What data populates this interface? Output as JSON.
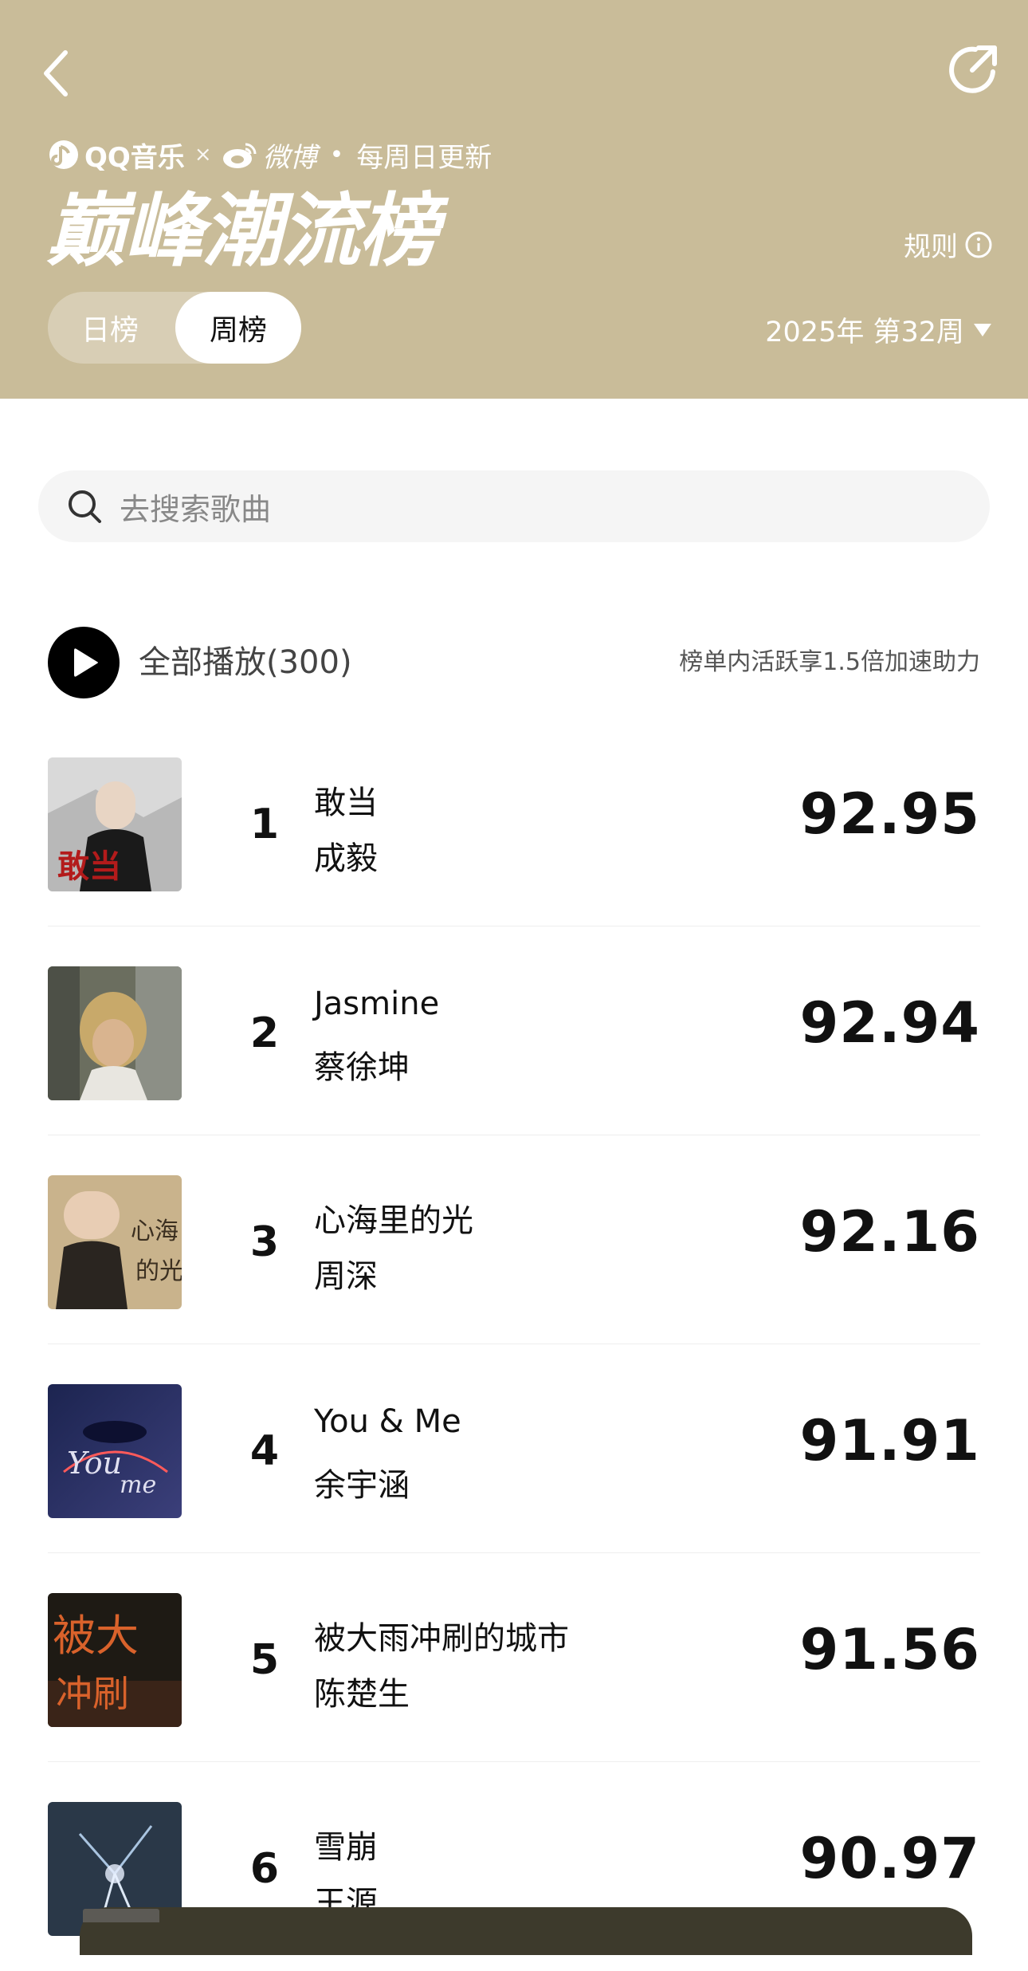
{
  "header": {
    "brand_qq": "QQ音乐",
    "brand_separator": "×",
    "brand_weibo": "微博",
    "update_note": "每周日更新",
    "title": "巅峰潮流榜",
    "rules_label": "规则",
    "tabs": [
      {
        "label": "日榜",
        "selected": false
      },
      {
        "label": "周榜",
        "selected": true
      }
    ],
    "week_selector": "2025年 第32周"
  },
  "search": {
    "placeholder": "去搜索歌曲"
  },
  "play_all": {
    "label": "全部播放(300)",
    "boost_note": "榜单内活跃享1.5倍加速助力"
  },
  "songs": [
    {
      "rank": "1",
      "title": "敢当",
      "artist": "成毅",
      "score": "92.95"
    },
    {
      "rank": "2",
      "title": "Jasmine",
      "artist": "蔡徐坤",
      "score": "92.94"
    },
    {
      "rank": "3",
      "title": "心海里的光",
      "artist": "周深",
      "score": "92.16"
    },
    {
      "rank": "4",
      "title": "You & Me",
      "artist": "余宇涵",
      "score": "91.91"
    },
    {
      "rank": "5",
      "title": "被大雨冲刷的城市",
      "artist": "陈楚生",
      "score": "91.56"
    },
    {
      "rank": "6",
      "title": "雪崩",
      "artist": "王源",
      "score": "90.97"
    }
  ],
  "colors": {
    "header_bg": "#c9bc99",
    "accent_text": "#ffffff",
    "mini_player_bg": "#3d3a2c"
  }
}
